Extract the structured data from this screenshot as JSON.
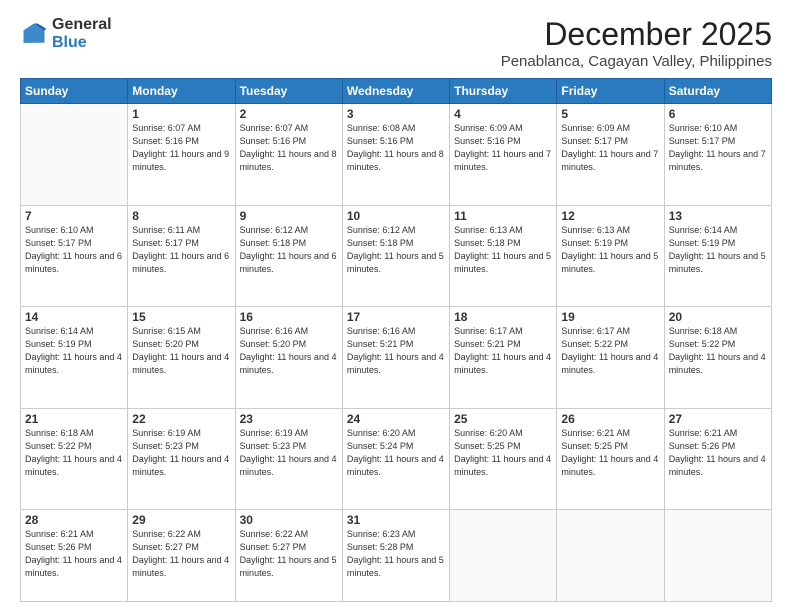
{
  "logo": {
    "general": "General",
    "blue": "Blue"
  },
  "header": {
    "month": "December 2025",
    "location": "Penablanca, Cagayan Valley, Philippines"
  },
  "weekdays": [
    "Sunday",
    "Monday",
    "Tuesday",
    "Wednesday",
    "Thursday",
    "Friday",
    "Saturday"
  ],
  "weeks": [
    [
      {
        "day": "",
        "sunrise": "",
        "sunset": "",
        "daylight": ""
      },
      {
        "day": "1",
        "sunrise": "Sunrise: 6:07 AM",
        "sunset": "Sunset: 5:16 PM",
        "daylight": "Daylight: 11 hours and 9 minutes."
      },
      {
        "day": "2",
        "sunrise": "Sunrise: 6:07 AM",
        "sunset": "Sunset: 5:16 PM",
        "daylight": "Daylight: 11 hours and 8 minutes."
      },
      {
        "day": "3",
        "sunrise": "Sunrise: 6:08 AM",
        "sunset": "Sunset: 5:16 PM",
        "daylight": "Daylight: 11 hours and 8 minutes."
      },
      {
        "day": "4",
        "sunrise": "Sunrise: 6:09 AM",
        "sunset": "Sunset: 5:16 PM",
        "daylight": "Daylight: 11 hours and 7 minutes."
      },
      {
        "day": "5",
        "sunrise": "Sunrise: 6:09 AM",
        "sunset": "Sunset: 5:17 PM",
        "daylight": "Daylight: 11 hours and 7 minutes."
      },
      {
        "day": "6",
        "sunrise": "Sunrise: 6:10 AM",
        "sunset": "Sunset: 5:17 PM",
        "daylight": "Daylight: 11 hours and 7 minutes."
      }
    ],
    [
      {
        "day": "7",
        "sunrise": "Sunrise: 6:10 AM",
        "sunset": "Sunset: 5:17 PM",
        "daylight": "Daylight: 11 hours and 6 minutes."
      },
      {
        "day": "8",
        "sunrise": "Sunrise: 6:11 AM",
        "sunset": "Sunset: 5:17 PM",
        "daylight": "Daylight: 11 hours and 6 minutes."
      },
      {
        "day": "9",
        "sunrise": "Sunrise: 6:12 AM",
        "sunset": "Sunset: 5:18 PM",
        "daylight": "Daylight: 11 hours and 6 minutes."
      },
      {
        "day": "10",
        "sunrise": "Sunrise: 6:12 AM",
        "sunset": "Sunset: 5:18 PM",
        "daylight": "Daylight: 11 hours and 5 minutes."
      },
      {
        "day": "11",
        "sunrise": "Sunrise: 6:13 AM",
        "sunset": "Sunset: 5:18 PM",
        "daylight": "Daylight: 11 hours and 5 minutes."
      },
      {
        "day": "12",
        "sunrise": "Sunrise: 6:13 AM",
        "sunset": "Sunset: 5:19 PM",
        "daylight": "Daylight: 11 hours and 5 minutes."
      },
      {
        "day": "13",
        "sunrise": "Sunrise: 6:14 AM",
        "sunset": "Sunset: 5:19 PM",
        "daylight": "Daylight: 11 hours and 5 minutes."
      }
    ],
    [
      {
        "day": "14",
        "sunrise": "Sunrise: 6:14 AM",
        "sunset": "Sunset: 5:19 PM",
        "daylight": "Daylight: 11 hours and 4 minutes."
      },
      {
        "day": "15",
        "sunrise": "Sunrise: 6:15 AM",
        "sunset": "Sunset: 5:20 PM",
        "daylight": "Daylight: 11 hours and 4 minutes."
      },
      {
        "day": "16",
        "sunrise": "Sunrise: 6:16 AM",
        "sunset": "Sunset: 5:20 PM",
        "daylight": "Daylight: 11 hours and 4 minutes."
      },
      {
        "day": "17",
        "sunrise": "Sunrise: 6:16 AM",
        "sunset": "Sunset: 5:21 PM",
        "daylight": "Daylight: 11 hours and 4 minutes."
      },
      {
        "day": "18",
        "sunrise": "Sunrise: 6:17 AM",
        "sunset": "Sunset: 5:21 PM",
        "daylight": "Daylight: 11 hours and 4 minutes."
      },
      {
        "day": "19",
        "sunrise": "Sunrise: 6:17 AM",
        "sunset": "Sunset: 5:22 PM",
        "daylight": "Daylight: 11 hours and 4 minutes."
      },
      {
        "day": "20",
        "sunrise": "Sunrise: 6:18 AM",
        "sunset": "Sunset: 5:22 PM",
        "daylight": "Daylight: 11 hours and 4 minutes."
      }
    ],
    [
      {
        "day": "21",
        "sunrise": "Sunrise: 6:18 AM",
        "sunset": "Sunset: 5:22 PM",
        "daylight": "Daylight: 11 hours and 4 minutes."
      },
      {
        "day": "22",
        "sunrise": "Sunrise: 6:19 AM",
        "sunset": "Sunset: 5:23 PM",
        "daylight": "Daylight: 11 hours and 4 minutes."
      },
      {
        "day": "23",
        "sunrise": "Sunrise: 6:19 AM",
        "sunset": "Sunset: 5:23 PM",
        "daylight": "Daylight: 11 hours and 4 minutes."
      },
      {
        "day": "24",
        "sunrise": "Sunrise: 6:20 AM",
        "sunset": "Sunset: 5:24 PM",
        "daylight": "Daylight: 11 hours and 4 minutes."
      },
      {
        "day": "25",
        "sunrise": "Sunrise: 6:20 AM",
        "sunset": "Sunset: 5:25 PM",
        "daylight": "Daylight: 11 hours and 4 minutes."
      },
      {
        "day": "26",
        "sunrise": "Sunrise: 6:21 AM",
        "sunset": "Sunset: 5:25 PM",
        "daylight": "Daylight: 11 hours and 4 minutes."
      },
      {
        "day": "27",
        "sunrise": "Sunrise: 6:21 AM",
        "sunset": "Sunset: 5:26 PM",
        "daylight": "Daylight: 11 hours and 4 minutes."
      }
    ],
    [
      {
        "day": "28",
        "sunrise": "Sunrise: 6:21 AM",
        "sunset": "Sunset: 5:26 PM",
        "daylight": "Daylight: 11 hours and 4 minutes."
      },
      {
        "day": "29",
        "sunrise": "Sunrise: 6:22 AM",
        "sunset": "Sunset: 5:27 PM",
        "daylight": "Daylight: 11 hours and 4 minutes."
      },
      {
        "day": "30",
        "sunrise": "Sunrise: 6:22 AM",
        "sunset": "Sunset: 5:27 PM",
        "daylight": "Daylight: 11 hours and 5 minutes."
      },
      {
        "day": "31",
        "sunrise": "Sunrise: 6:23 AM",
        "sunset": "Sunset: 5:28 PM",
        "daylight": "Daylight: 11 hours and 5 minutes."
      },
      {
        "day": "",
        "sunrise": "",
        "sunset": "",
        "daylight": ""
      },
      {
        "day": "",
        "sunrise": "",
        "sunset": "",
        "daylight": ""
      },
      {
        "day": "",
        "sunrise": "",
        "sunset": "",
        "daylight": ""
      }
    ]
  ]
}
